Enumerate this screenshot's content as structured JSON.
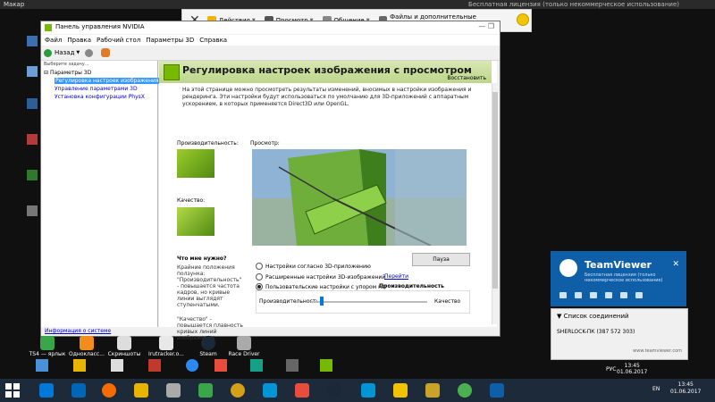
{
  "top_strip": {
    "left": "Макар",
    "right": "Бесплатная лицензия (только некоммерческое использование)"
  },
  "tv_toolbar": {
    "close": "✕",
    "items": [
      "Действия",
      "Просмотр",
      "Общение",
      "Файлы и дополнительные возможности"
    ]
  },
  "nvidia": {
    "title": "Панель управления NVIDIA",
    "menu": [
      "Файл",
      "Правка",
      "Рабочий стол",
      "Параметры 3D",
      "Справка"
    ],
    "nav_back": "Назад",
    "task_label": "Выберите задачу...",
    "tree_root": "Параметры 3D",
    "tree_items": [
      "Регулировка настроек изображения с п",
      "Управление параметрами 3D",
      "Установка конфигурации PhysX"
    ],
    "sysinfo": "Информация о системе",
    "header_title": "Регулировка настроек изображения с просмотром",
    "restore": "Восстановить",
    "description": "На этой странице можно просмотреть результаты изменений, вносимых в настройки изображения и рендеринга. Эти настройки будут использоваться по умолчанию для 3D-приложений с аппаратным ускорением, в которых применяется Direct3D или OpenGL.",
    "perf_label": "Производительность:",
    "quality_label": "Качество:",
    "preview_label": "Просмотр:",
    "what_need": "Что мне нужно?",
    "what_need_text": "Крайние положения ползунка: \"Производительность\" - повышается частота кадров, но кривые линии выглядят ступенчатыми.",
    "quality_note": "\"Качество\" - повышается плавность кривых линий изображения.",
    "pause": "Пауза",
    "radios": [
      "Настройки согласно 3D-приложению",
      "Расширенные настройки 3D-изображений",
      "Пользовательские настройки с упором на:"
    ],
    "go_link": "Перейти",
    "perf_heading": "Производительность",
    "slider_left": "Производительность",
    "slider_right": "Качество",
    "slider_position": 0.08
  },
  "desktop_icons": [
    "TS4 — ярлык",
    "Однокласс...",
    "Скриншоты",
    "Irutracker.o...",
    "Steam",
    "Race Driver"
  ],
  "teamviewer_panel": {
    "name": "TeamViewer",
    "sub": "Бесплатная лицензия (только некоммерческое использование)",
    "close": "✕",
    "conn_head": "Список соединений",
    "conn_row": "SHERLOCK-ПК (387 572 303)",
    "footer": "www.teamviewer.com"
  },
  "tray": {
    "lang": "РУС",
    "time": "13:45",
    "date": "01.06.2017"
  },
  "taskbar": {
    "lang": "EN",
    "time": "13:45",
    "date": "01.06.2017"
  }
}
